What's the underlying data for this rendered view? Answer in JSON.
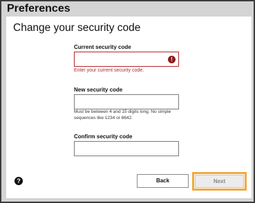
{
  "window": {
    "title": "Preferences"
  },
  "dialog": {
    "heading": "Change your security code",
    "current": {
      "label": "Current security code",
      "value": "",
      "error": "Enter your current security code."
    },
    "new": {
      "label": "New security code",
      "value": "",
      "help": "Must be between 4 and 15 digits long. No simple sequences like 1234 or 8642."
    },
    "confirm": {
      "label": "Confirm security code",
      "value": ""
    },
    "buttons": {
      "back": "Back",
      "next": "Next"
    },
    "help_glyph": "?",
    "error_glyph": "!"
  },
  "colors": {
    "error": "#b3262a",
    "focus": "#f2a93b"
  }
}
